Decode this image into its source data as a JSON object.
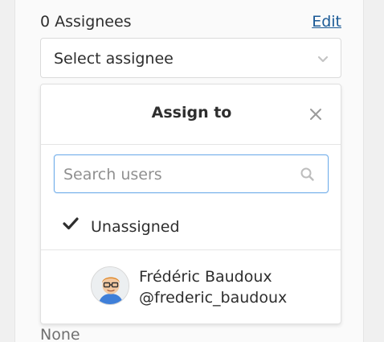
{
  "assignees": {
    "count_label": "0 Assignees",
    "edit_label": "Edit",
    "select_value": "Select assignee",
    "none_label": "None"
  },
  "dropdown": {
    "title": "Assign to",
    "search_placeholder": "Search users",
    "unassigned_label": "Unassigned",
    "users": [
      {
        "name": "Frédéric Baudoux",
        "username": "@frederic_baudoux"
      }
    ]
  },
  "colors": {
    "link": "#1b5a96",
    "focus_border": "#73afea",
    "text": "#2e2e2e",
    "muted": "#909090"
  },
  "icons": [
    "chevron-down-icon",
    "close-icon",
    "search-icon",
    "check-icon",
    "avatar"
  ]
}
